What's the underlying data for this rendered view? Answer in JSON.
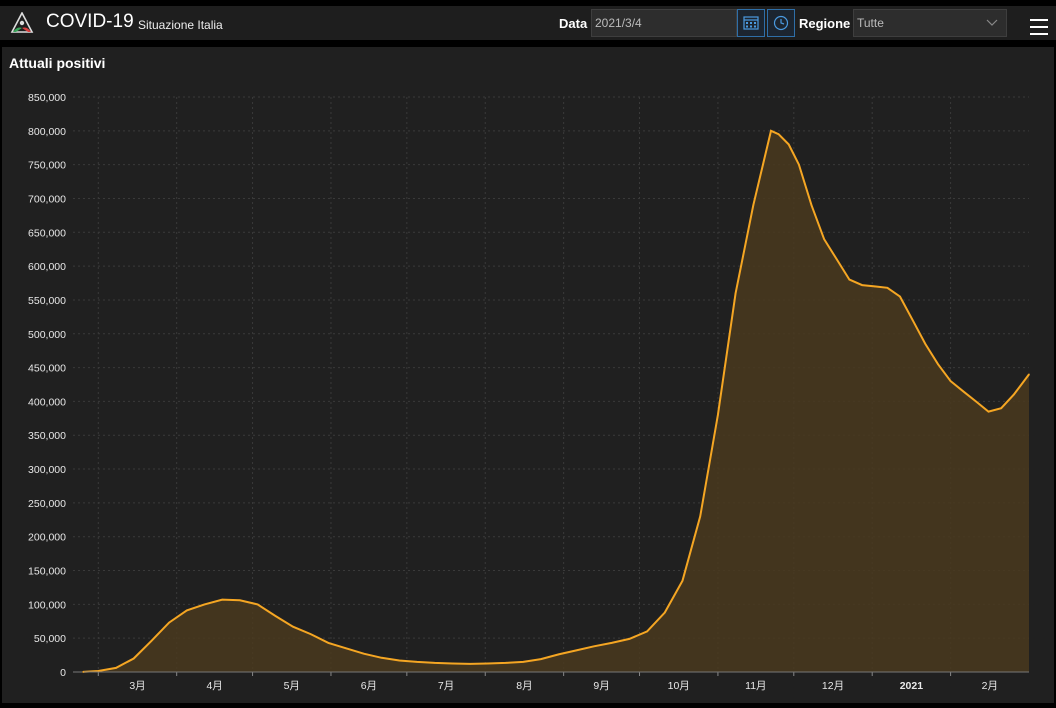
{
  "header": {
    "title": "COVID-19",
    "subtitle": "Situazione Italia",
    "data_label": "Data",
    "data_value": "2021/3/4",
    "regione_label": "Regione",
    "regione_value": "Tutte",
    "icons": [
      "italy-emblem-icon",
      "calendar-icon",
      "clock-icon",
      "chevron-down-icon",
      "hamburger-menu-icon"
    ]
  },
  "panel": {
    "title": "Attuali positivi"
  },
  "colors": {
    "line": "#f5a623",
    "fill": "#4a3a1e",
    "grid": "#3a3a3a",
    "background": "#202020",
    "accent": "#2f6fa8"
  },
  "chart_data": {
    "type": "area",
    "title": "Attuali positivi",
    "xlabel": "",
    "ylabel": "",
    "ylim": [
      0,
      850000
    ],
    "yticks": [
      "0",
      "50,000",
      "100,000",
      "150,000",
      "200,000",
      "250,000",
      "300,000",
      "350,000",
      "400,000",
      "450,000",
      "500,000",
      "550,000",
      "600,000",
      "650,000",
      "700,000",
      "750,000",
      "800,000",
      "850,000"
    ],
    "xlim": [
      "2020-02-20",
      "2021-03-04"
    ],
    "xticks": [
      {
        "label": "3月",
        "date": "2020-03-01"
      },
      {
        "label": "4月",
        "date": "2020-04-01"
      },
      {
        "label": "5月",
        "date": "2020-05-01"
      },
      {
        "label": "6月",
        "date": "2020-06-01"
      },
      {
        "label": "7月",
        "date": "2020-07-01"
      },
      {
        "label": "8月",
        "date": "2020-08-01"
      },
      {
        "label": "9月",
        "date": "2020-09-01"
      },
      {
        "label": "10月",
        "date": "2020-10-01"
      },
      {
        "label": "11月",
        "date": "2020-11-01"
      },
      {
        "label": "12月",
        "date": "2020-12-01"
      },
      {
        "label": "2021",
        "date": "2021-01-01"
      },
      {
        "label": "2月",
        "date": "2021-02-01"
      }
    ],
    "grid": true,
    "series": [
      {
        "points": [
          [
            "2020-02-24",
            200
          ],
          [
            "2020-03-01",
            1500
          ],
          [
            "2020-03-08",
            6000
          ],
          [
            "2020-03-15",
            20000
          ],
          [
            "2020-03-22",
            46000
          ],
          [
            "2020-03-29",
            73000
          ],
          [
            "2020-04-05",
            91000
          ],
          [
            "2020-04-12",
            100000
          ],
          [
            "2020-04-19",
            107000
          ],
          [
            "2020-04-26",
            106000
          ],
          [
            "2020-05-03",
            100000
          ],
          [
            "2020-05-10",
            83000
          ],
          [
            "2020-05-17",
            67000
          ],
          [
            "2020-05-24",
            56000
          ],
          [
            "2020-05-31",
            43000
          ],
          [
            "2020-06-07",
            35000
          ],
          [
            "2020-06-14",
            27000
          ],
          [
            "2020-06-21",
            21000
          ],
          [
            "2020-06-28",
            17000
          ],
          [
            "2020-07-05",
            15000
          ],
          [
            "2020-07-12",
            13500
          ],
          [
            "2020-07-19",
            12500
          ],
          [
            "2020-07-26",
            12000
          ],
          [
            "2020-08-02",
            12500
          ],
          [
            "2020-08-09",
            13500
          ],
          [
            "2020-08-16",
            15000
          ],
          [
            "2020-08-23",
            19000
          ],
          [
            "2020-08-30",
            26000
          ],
          [
            "2020-09-06",
            32000
          ],
          [
            "2020-09-13",
            38000
          ],
          [
            "2020-09-20",
            43000
          ],
          [
            "2020-09-27",
            49000
          ],
          [
            "2020-10-04",
            60000
          ],
          [
            "2020-10-11",
            88000
          ],
          [
            "2020-10-18",
            135000
          ],
          [
            "2020-10-25",
            230000
          ],
          [
            "2020-11-01",
            380000
          ],
          [
            "2020-11-08",
            560000
          ],
          [
            "2020-11-15",
            690000
          ],
          [
            "2020-11-22",
            800000
          ],
          [
            "2020-11-25",
            795000
          ],
          [
            "2020-11-29",
            780000
          ],
          [
            "2020-12-03",
            750000
          ],
          [
            "2020-12-08",
            690000
          ],
          [
            "2020-12-13",
            640000
          ],
          [
            "2020-12-18",
            610000
          ],
          [
            "2020-12-23",
            580000
          ],
          [
            "2020-12-28",
            572000
          ],
          [
            "2021-01-02",
            570000
          ],
          [
            "2021-01-07",
            568000
          ],
          [
            "2021-01-12",
            555000
          ],
          [
            "2021-01-17",
            520000
          ],
          [
            "2021-01-22",
            485000
          ],
          [
            "2021-01-27",
            455000
          ],
          [
            "2021-02-01",
            430000
          ],
          [
            "2021-02-06",
            415000
          ],
          [
            "2021-02-11",
            400000
          ],
          [
            "2021-02-16",
            385000
          ],
          [
            "2021-02-21",
            390000
          ],
          [
            "2021-02-26",
            410000
          ],
          [
            "2021-03-04",
            440000
          ]
        ]
      }
    ]
  }
}
